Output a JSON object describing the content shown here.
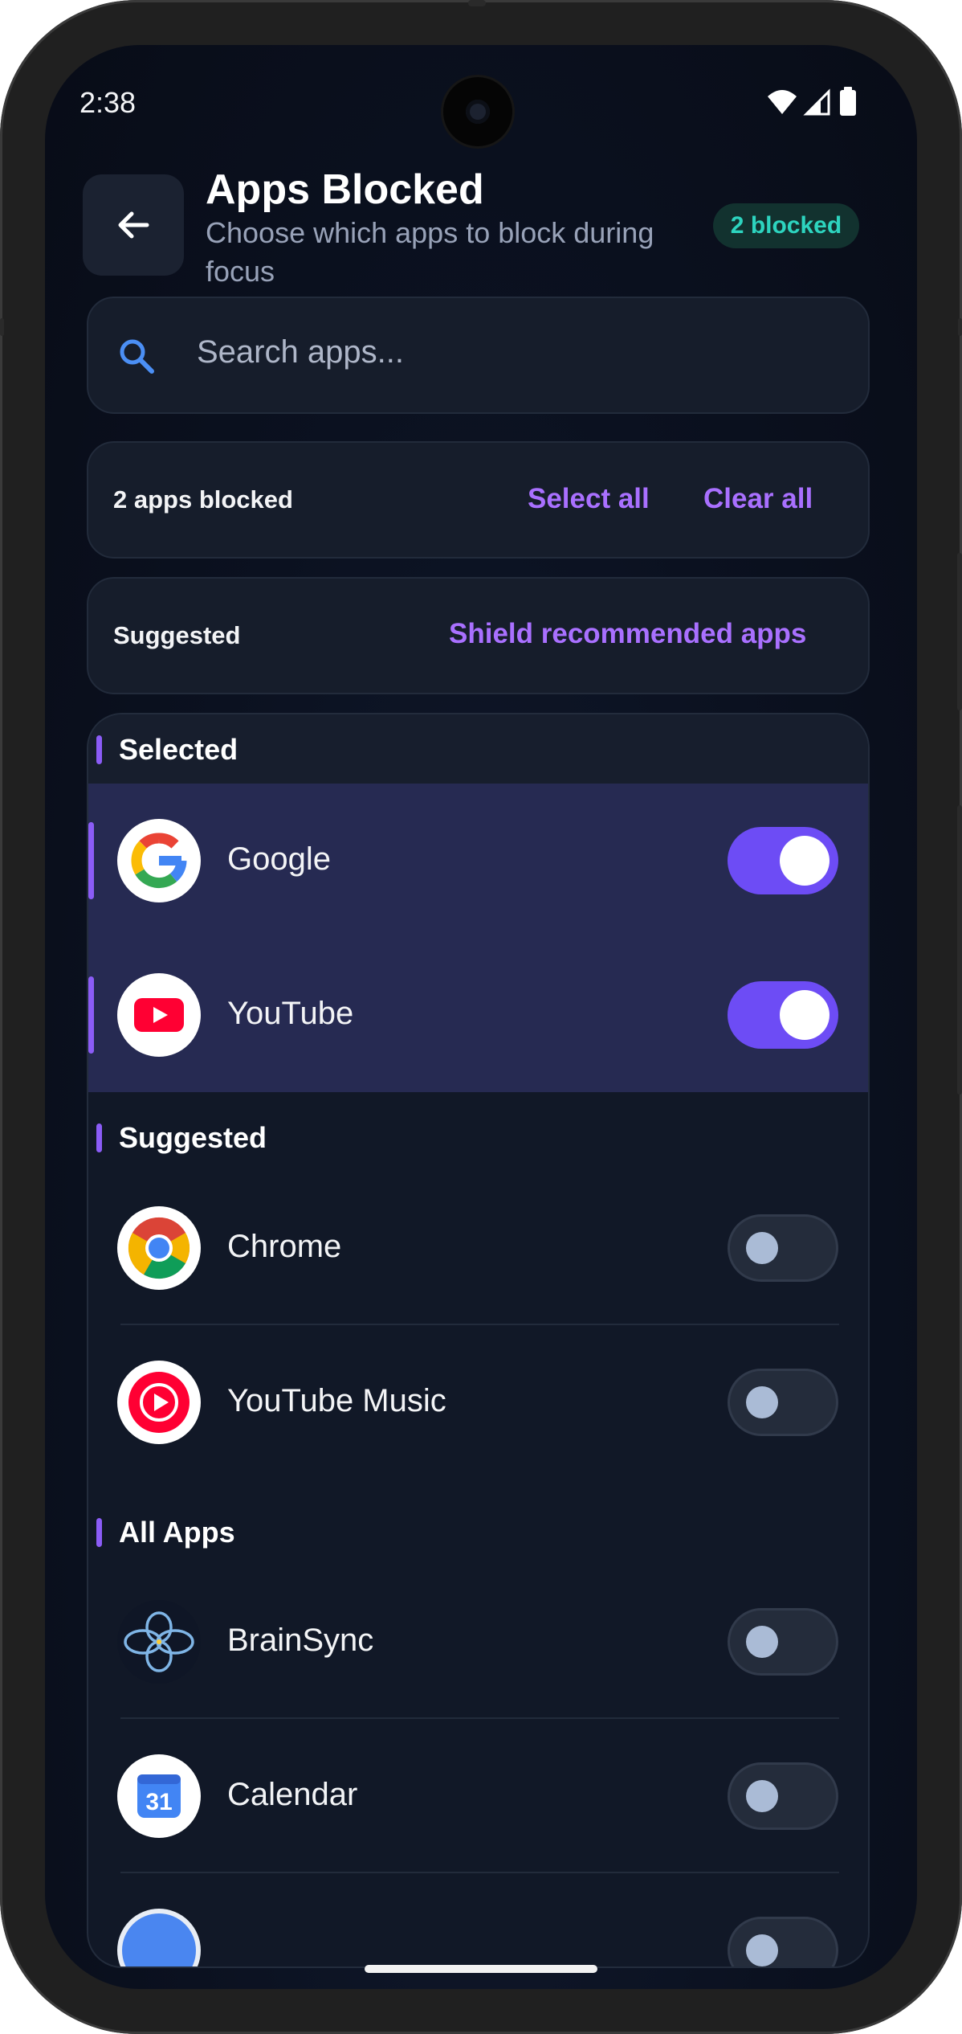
{
  "status_bar": {
    "time": "2:38"
  },
  "header": {
    "title": "Apps Blocked",
    "subtitle": "Choose which apps to block during focus",
    "badge": "2 blocked"
  },
  "search": {
    "placeholder": "Search apps..."
  },
  "summary_bar": {
    "count_text": "2 apps blocked",
    "select_all": "Select all",
    "clear_all": "Clear all"
  },
  "suggested_bar": {
    "label": "Suggested",
    "action": "Shield recommended apps"
  },
  "sections": {
    "selected": "Selected",
    "suggested": "Suggested",
    "all_apps": "All Apps"
  },
  "apps": {
    "google": {
      "name": "Google",
      "blocked": true
    },
    "youtube": {
      "name": "YouTube",
      "blocked": true
    },
    "chrome": {
      "name": "Chrome",
      "blocked": false
    },
    "youtube_music": {
      "name": "YouTube Music",
      "blocked": false
    },
    "brainsync": {
      "name": "BrainSync",
      "blocked": false
    },
    "calendar": {
      "name": "Calendar",
      "blocked": false,
      "icon_text": "31"
    }
  },
  "colors": {
    "accent": "#8b5cf6",
    "toggle_on": "#6d4cf5",
    "badge_text": "#2dd4bf",
    "link": "#a970ff"
  }
}
